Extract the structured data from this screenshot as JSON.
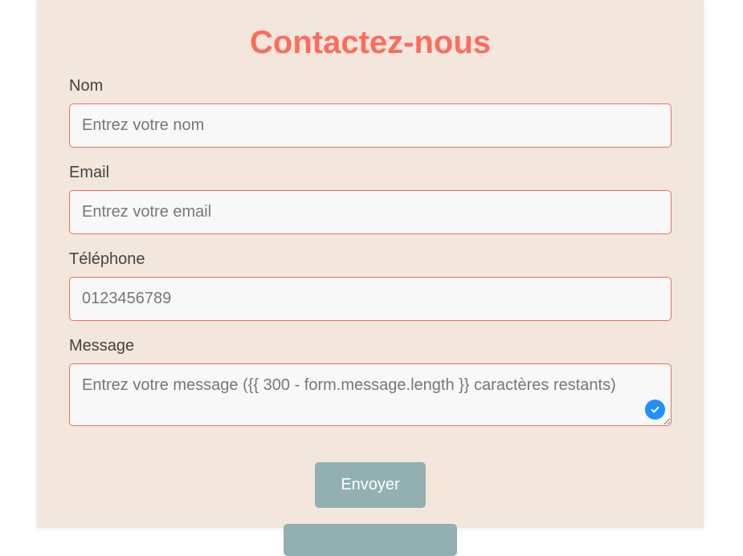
{
  "form": {
    "title": "Contactez-nous",
    "fields": {
      "name": {
        "label": "Nom",
        "placeholder": "Entrez votre nom",
        "value": ""
      },
      "email": {
        "label": "Email",
        "placeholder": "Entrez votre email",
        "value": ""
      },
      "phone": {
        "label": "Téléphone",
        "placeholder": "0123456789",
        "value": ""
      },
      "message": {
        "label": "Message",
        "placeholder": "Entrez votre message ({{ 300 - form.message.length }} caractères restants)",
        "value": ""
      }
    },
    "submit_label": "Envoyer",
    "secondary_button_label": ""
  },
  "icons": {
    "textarea_badge": "checkmark-icon"
  },
  "colors": {
    "card_background": "#f2e6dd",
    "title": "#ff6b5c",
    "field_border": "#e87068",
    "button": "#92b0b2",
    "badge": "#1e90ff"
  }
}
